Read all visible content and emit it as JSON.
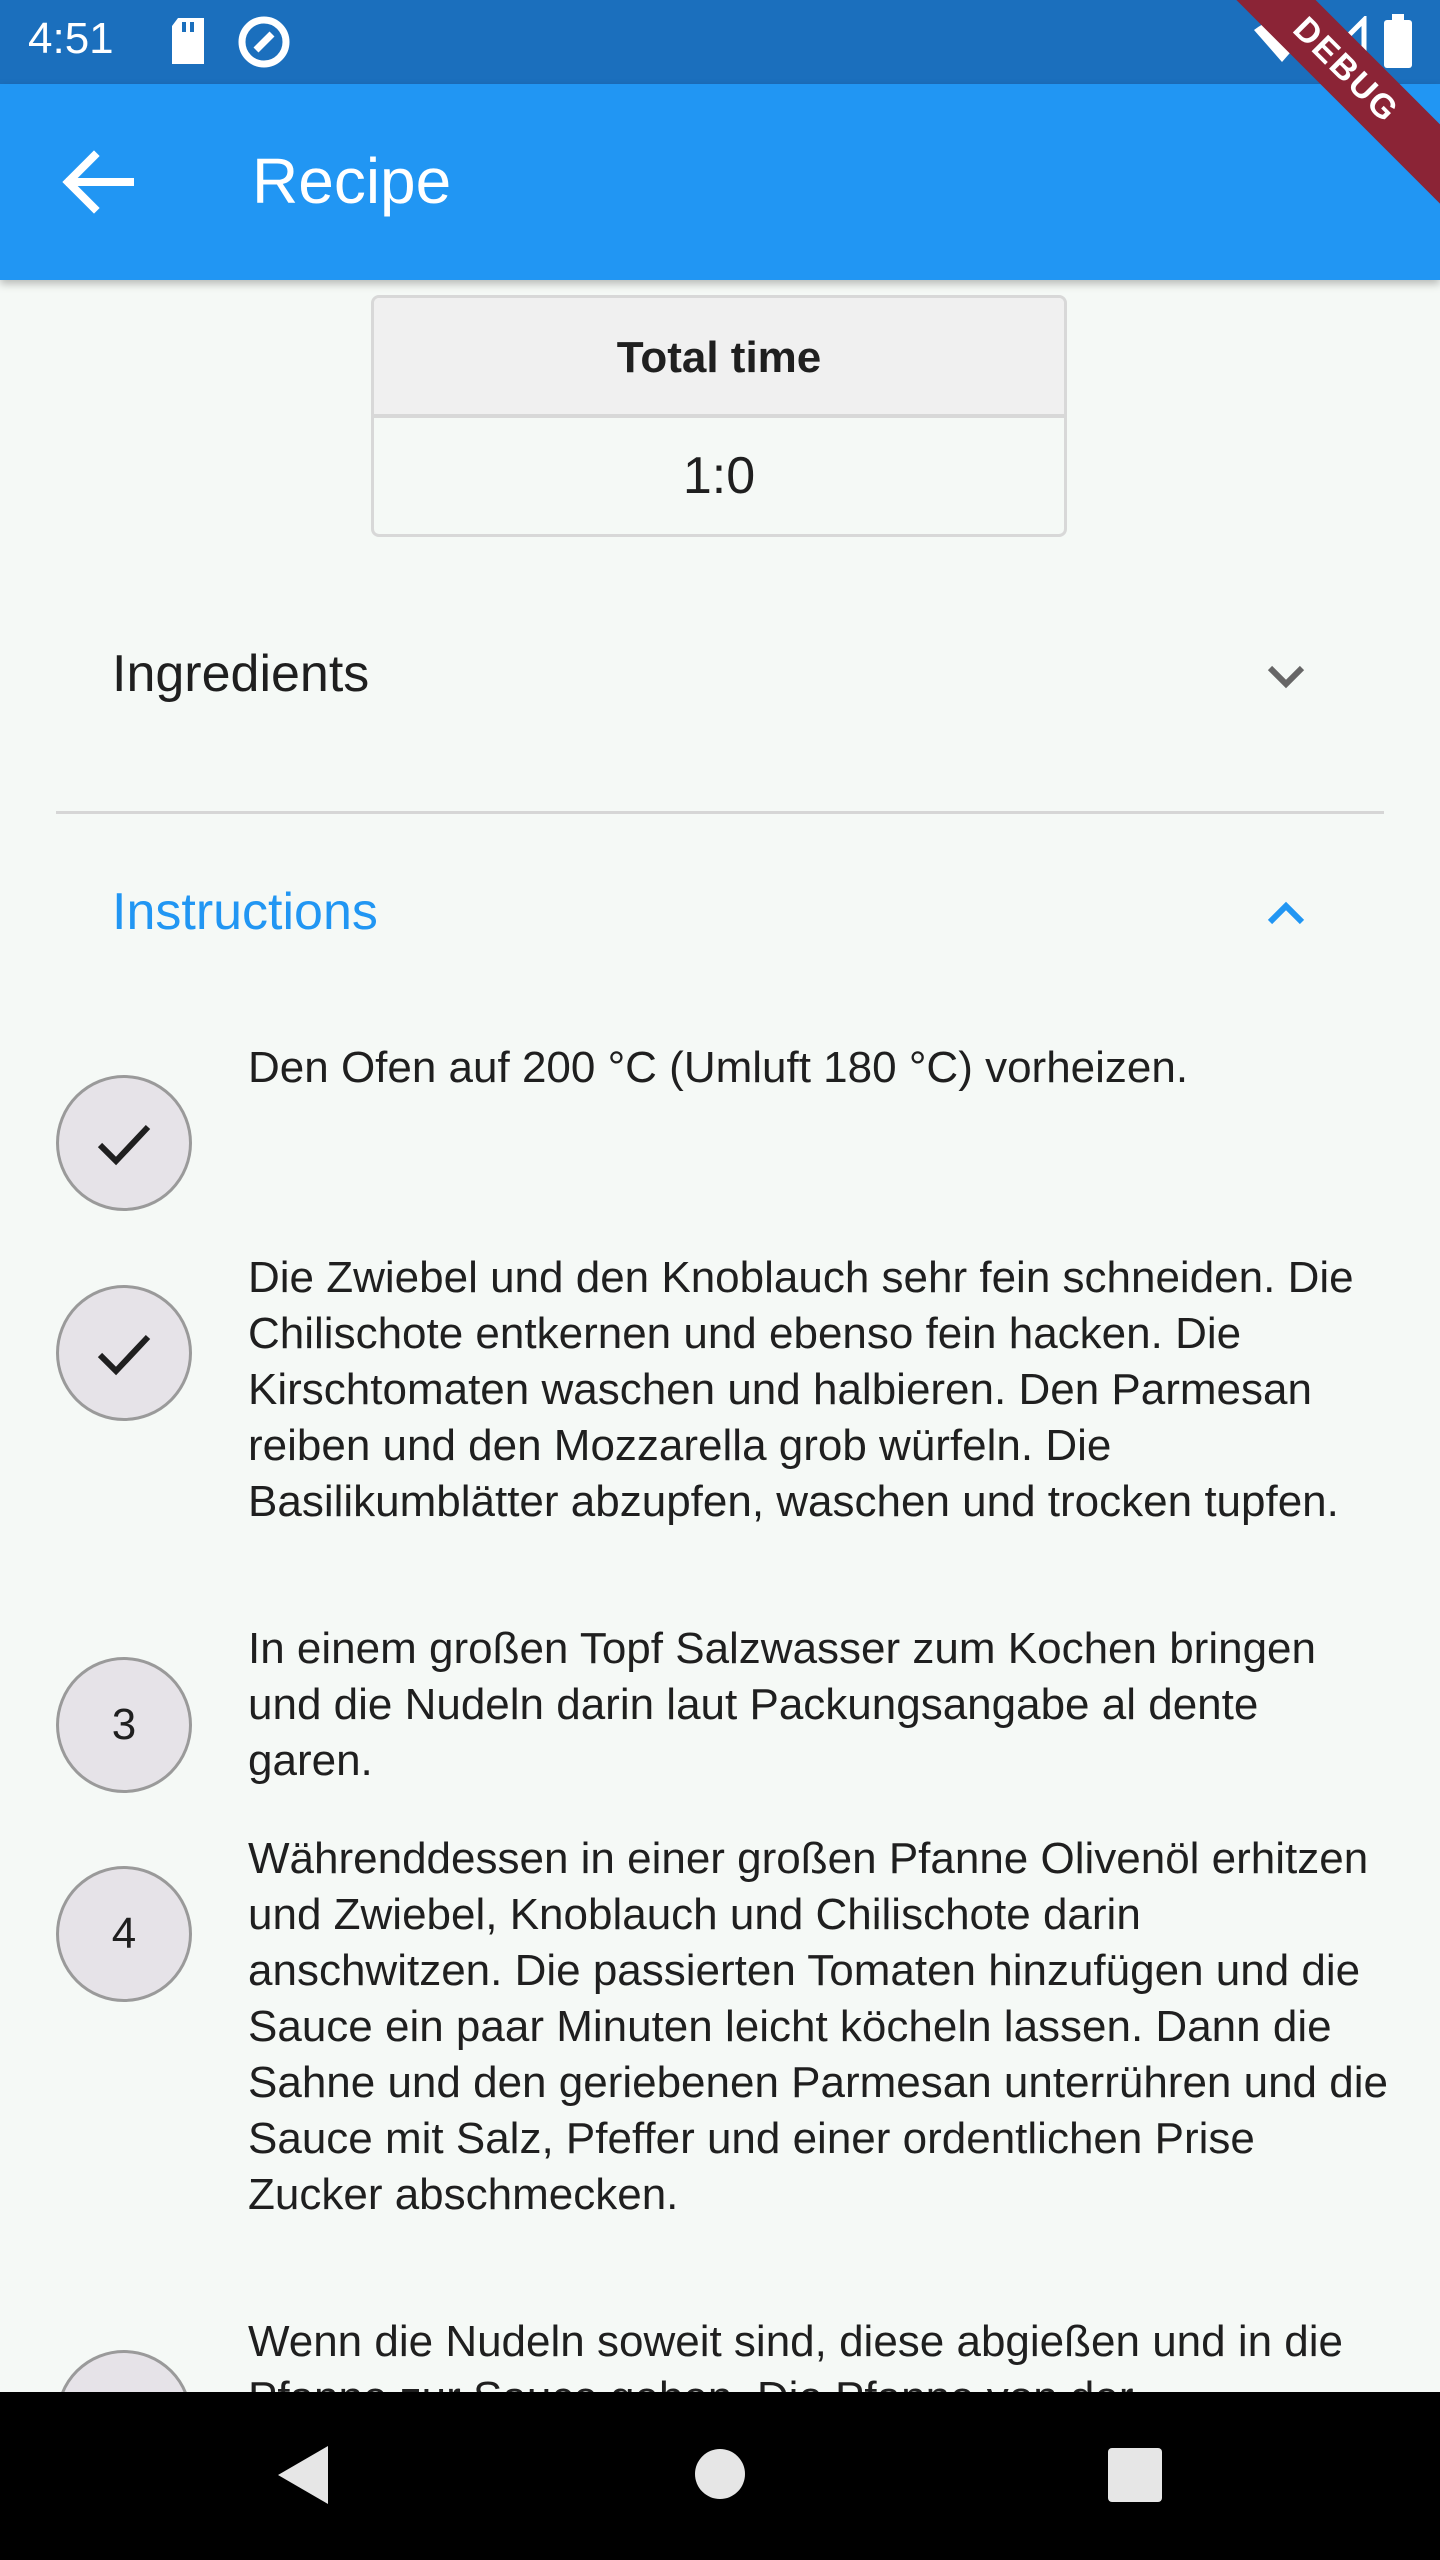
{
  "status_bar": {
    "time": "4:51",
    "debug_label": "DEBUG"
  },
  "app_bar": {
    "title": "Recipe",
    "back_icon": "arrow-back-icon"
  },
  "total_time": {
    "header": "Total time",
    "value": "1:0"
  },
  "sections": {
    "ingredients": {
      "label": "Ingredients",
      "expanded": false
    },
    "instructions": {
      "label": "Instructions",
      "expanded": true
    }
  },
  "steps": [
    {
      "marker": "",
      "completed": true,
      "text": "Den Ofen auf 200 °C (Umluft 180 °C) vorheizen."
    },
    {
      "marker": "",
      "completed": true,
      "text": "Die Zwiebel und den Knoblauch sehr fein schneiden. Die Chilischote entkernen und ebenso fein hacken. Die Kirschtomaten waschen und halbieren. Den Parmesan reiben und den Mozzarella grob würfeln. Die Basilikumblätter abzupfen, waschen und trocken tupfen."
    },
    {
      "marker": "3",
      "completed": false,
      "text": "In einem großen Topf Salzwasser zum Kochen bringen und die Nudeln darin laut Packungsangabe al dente garen."
    },
    {
      "marker": "4",
      "completed": false,
      "text": "Währenddessen in einer großen Pfanne Olivenöl erhitzen und Zwiebel, Knoblauch und Chilischote darin anschwitzen. Die passierten Tomaten hinzufügen und die Sauce ein paar Minuten leicht köcheln lassen. Dann die Sahne und den geriebenen Parmesan unterrühren und die Sauce mit Salz, Pfeffer und einer ordentlichen Prise Zucker abschmecken."
    },
    {
      "marker": "",
      "completed": false,
      "text": "Wenn die Nudeln soweit sind, diese abgießen und in die Pfanne zur Sauce geben. Die Pfanne von der"
    }
  ],
  "colors": {
    "status_bar": "#1b6fbd",
    "app_bar": "#2196f3",
    "accent": "#2196f3",
    "background": "#f5f9f6",
    "debug_ribbon": "#8b2436"
  },
  "nav_bar": {
    "back_icon": "nav-back-icon",
    "home_icon": "nav-home-icon",
    "recents_icon": "nav-recents-icon"
  }
}
